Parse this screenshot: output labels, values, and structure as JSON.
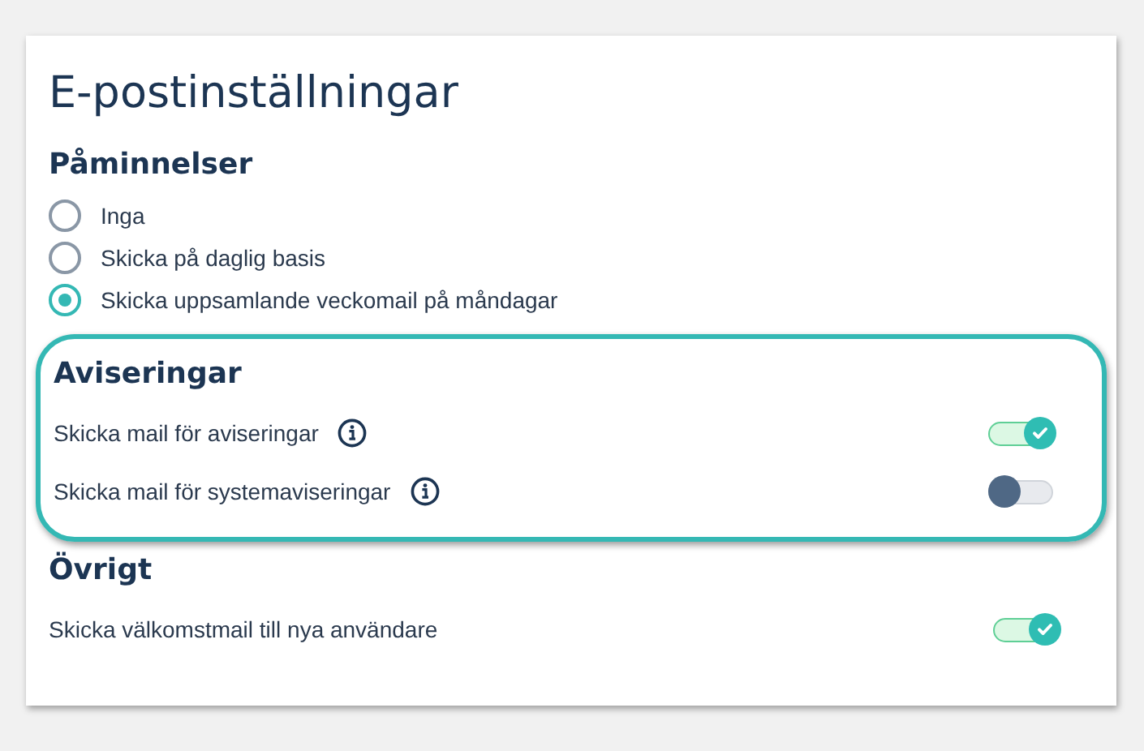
{
  "title": "E-postinställningar",
  "sections": [
    {
      "heading": "Påminnelser",
      "highlighted": false,
      "kind": "radios",
      "options": [
        {
          "label": "Inga",
          "selected": false
        },
        {
          "label": "Skicka på daglig basis",
          "selected": false
        },
        {
          "label": "Skicka uppsamlande veckomail på måndagar",
          "selected": true
        }
      ]
    },
    {
      "heading": "Aviseringar",
      "highlighted": true,
      "kind": "toggles",
      "options": [
        {
          "label": "Skicka mail för aviseringar",
          "info": true,
          "on": true
        },
        {
          "label": "Skicka mail för systemaviseringar",
          "info": true,
          "on": false
        }
      ]
    },
    {
      "heading": "Övrigt",
      "highlighted": false,
      "kind": "toggles",
      "options": [
        {
          "label": "Skicka välkomstmail till nya användare",
          "info": false,
          "on": true
        }
      ]
    }
  ]
}
